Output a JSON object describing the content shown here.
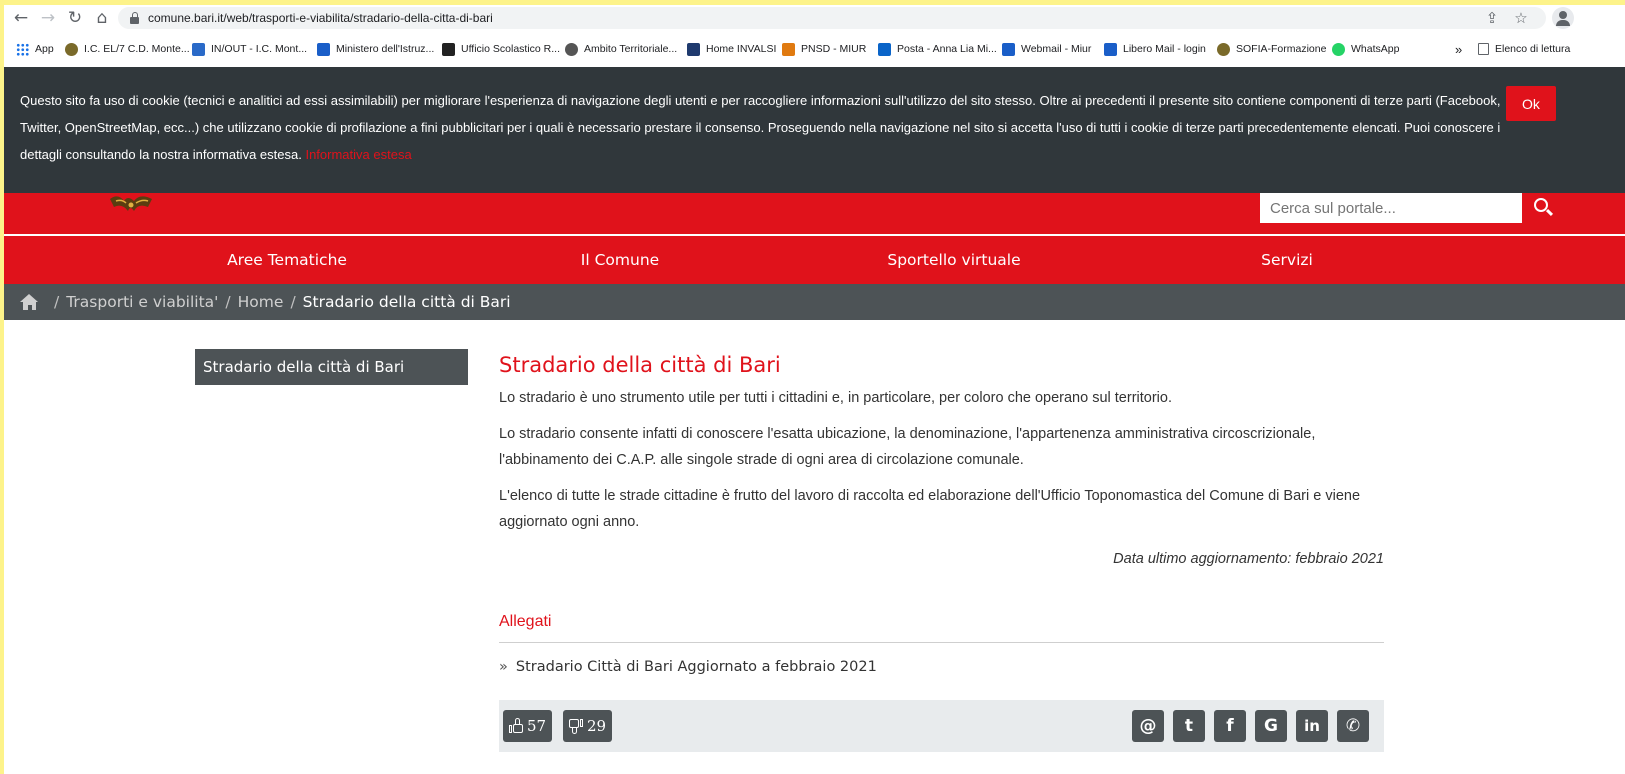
{
  "browser": {
    "url": "comune.bari.it/web/trasporti-e-viabilita/stradario-della-citta-di-bari",
    "bookmarks": [
      {
        "label": "App",
        "icon": "apps-grid-icon",
        "color": "#1a73e8"
      },
      {
        "label": "I.C. EL/7 C.D. Monte...",
        "icon": "emblem-icon",
        "color": "#7a6a2a"
      },
      {
        "label": "IN/OUT - I.C. Mont...",
        "icon": "inout-icon",
        "color": "#2a6ac8"
      },
      {
        "label": "Ministero dell'Istruz...",
        "icon": "ministry-icon",
        "color": "#1a5ec8"
      },
      {
        "label": "Ufficio Scolastico R...",
        "icon": "usr-icon",
        "color": "#222222"
      },
      {
        "label": "Ambito Territoriale...",
        "icon": "globe-icon",
        "color": "#555555"
      },
      {
        "label": "Home INVALSI",
        "icon": "invalsi-icon",
        "color": "#1f3a6e"
      },
      {
        "label": "PNSD - MIUR",
        "icon": "pnsd-icon",
        "color": "#e07a10"
      },
      {
        "label": "Posta - Anna Lia Mi...",
        "icon": "outlook-icon",
        "color": "#0a64c8"
      },
      {
        "label": "Webmail - Miur",
        "icon": "webmail-icon",
        "color": "#1a5ec8"
      },
      {
        "label": "Libero Mail - login",
        "icon": "libero-icon",
        "color": "#1a5ec8"
      },
      {
        "label": "SOFIA-Formazione",
        "icon": "emblem-icon",
        "color": "#7a6a2a"
      },
      {
        "label": "WhatsApp",
        "icon": "whatsapp-icon",
        "color": "#25d366"
      }
    ],
    "overflow_label": "»",
    "reading_list_label": "Elenco di lettura"
  },
  "cookie_banner": {
    "text": "Questo sito fa uso di cookie (tecnici e analitici ad essi assimilabili) per migliorare l'esperienza di navigazione degli utenti e per raccogliere informazioni sull'utilizzo del sito stesso. Oltre ai precedenti il presente sito contiene componenti di terze parti (Facebook, Twitter, OpenStreetMap, ecc...) che utilizzano cookie di profilazione a fini pubblicitari per i quali è necessario prestare il consenso. Proseguendo nella navigazione nel sito si accetta l'uso di tutti i cookie di terze parti precedentemente elencati. Puoi conoscere i dettagli consultando la nostra informativa estesa.",
    "link_label": "Informativa estesa",
    "ok_label": "Ok"
  },
  "header": {
    "search_placeholder": "Cerca sul portale..."
  },
  "nav": {
    "items": [
      "Aree Tematiche",
      "Il Comune",
      "Sportello virtuale",
      "Servizi"
    ]
  },
  "breadcrumb": {
    "items": [
      "Trasporti e viabilita'",
      "Home",
      "Stradario della città di Bari"
    ],
    "separator": "/"
  },
  "sidebar": {
    "item": "Stradario della città di Bari"
  },
  "content": {
    "title": "Stradario della città di Bari",
    "paragraphs": [
      "Lo stradario è uno strumento utile per tutti i cittadini e, in particolare, per coloro che operano sul territorio.",
      "Lo stradario consente infatti di conoscere l'esatta ubicazione, la denominazione, l'appartenenza amministrativa circoscrizionale, l'abbinamento dei C.A.P. alle singole strade di ogni area di circolazione comunale.",
      "L'elenco di tutte le strade cittadine è frutto del lavoro di raccolta ed elaborazione dell'Ufficio Toponomastica del Comune di Bari e viene aggiornato ogni anno."
    ],
    "updated": "Data ultimo aggiornamento: febbraio 2021",
    "attachments_title": "Allegati",
    "attachment_bullet": "»",
    "attachment": "Stradario Città di Bari Aggiornato a febbraio 2021"
  },
  "feedback": {
    "likes": "57",
    "dislikes": "29"
  },
  "share": {
    "buttons": [
      {
        "label": "@",
        "icon": "email-icon"
      },
      {
        "label": "t",
        "icon": "twitter-icon"
      },
      {
        "label": "f",
        "icon": "facebook-icon"
      },
      {
        "label": "G",
        "icon": "google-icon"
      },
      {
        "label": "in",
        "icon": "linkedin-icon"
      },
      {
        "label": "✆",
        "icon": "whatsapp-icon"
      }
    ]
  },
  "colors": {
    "brand_red": "#e0121b",
    "dark_gray": "#4d5356",
    "cookie_bg": "#30373b",
    "page_border": "#fdf38a"
  }
}
